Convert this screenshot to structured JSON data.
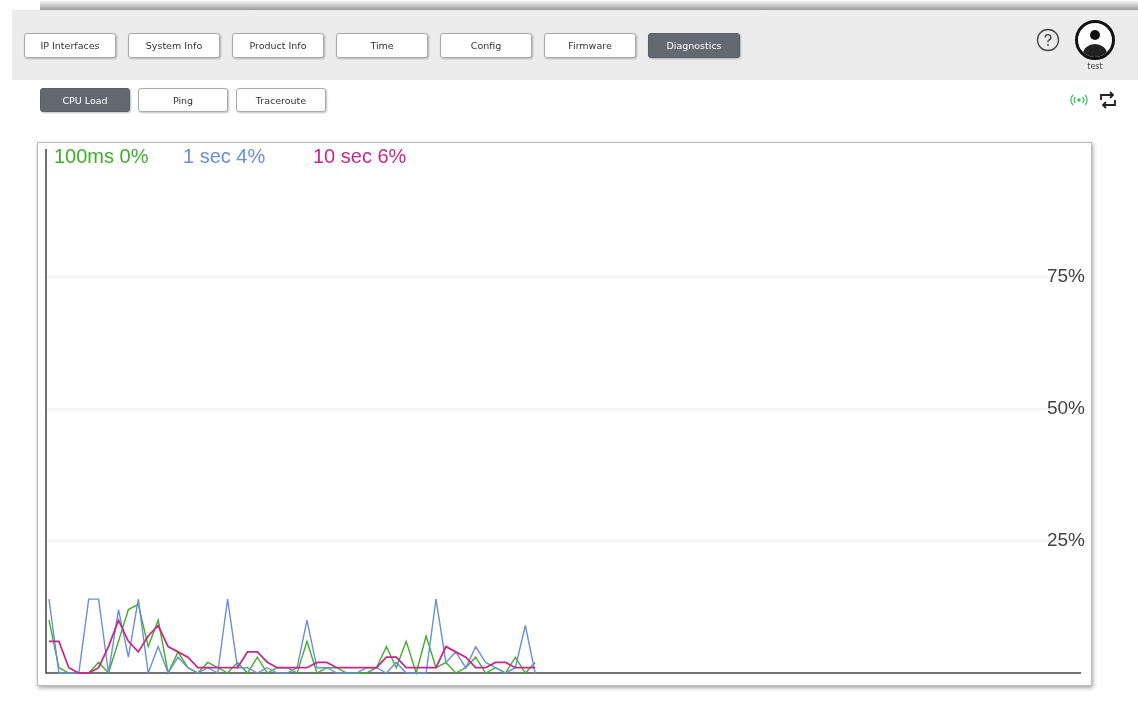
{
  "tabs": [
    {
      "label": "IP Interfaces",
      "selected": false
    },
    {
      "label": "System Info",
      "selected": false
    },
    {
      "label": "Product Info",
      "selected": false
    },
    {
      "label": "Time",
      "selected": false
    },
    {
      "label": "Config",
      "selected": false
    },
    {
      "label": "Firmware",
      "selected": false
    },
    {
      "label": "Diagnostics",
      "selected": true
    }
  ],
  "user": {
    "name": "test"
  },
  "subtabs": [
    {
      "label": "CPU Load",
      "selected": true
    },
    {
      "label": "Ping",
      "selected": false
    },
    {
      "label": "Traceroute",
      "selected": false
    }
  ],
  "chart": {
    "chart_data": {
      "type": "line",
      "categories": [
        null,
        null,
        null,
        null,
        null,
        null,
        null,
        null,
        null,
        null,
        null,
        null,
        null,
        null,
        null,
        null,
        null,
        null,
        null,
        null,
        null,
        null,
        null,
        null,
        null,
        null,
        null,
        null,
        null,
        null,
        null,
        null,
        null,
        null,
        null,
        null,
        null,
        null,
        null,
        null,
        null,
        null,
        null,
        null,
        null,
        null,
        null,
        null,
        null,
        null,
        null,
        null,
        null,
        null,
        null,
        null,
        null,
        null,
        null,
        null,
        null,
        null,
        null,
        null,
        null,
        null,
        null,
        null,
        null,
        null,
        null,
        null,
        null,
        null,
        null,
        null,
        null,
        null,
        null,
        null,
        null,
        null,
        null,
        null,
        null,
        null,
        null,
        null,
        null,
        null,
        null,
        null,
        null,
        null,
        null,
        null,
        null,
        null,
        null,
        null,
        null,
        null,
        null,
        null,
        null
      ],
      "ylim": [
        0,
        100
      ],
      "grid": true,
      "yticks": [
        {
          "value": 25,
          "label": "25%"
        },
        {
          "value": 50,
          "label": "50%"
        },
        {
          "value": 75,
          "label": "75%"
        }
      ],
      "series": [
        {
          "name": "100ms 0%",
          "color": "#3fae2a",
          "values": [
            10,
            1,
            0,
            0,
            0,
            2,
            0,
            6,
            12,
            13,
            5,
            10,
            0,
            4,
            1,
            0,
            2,
            1,
            0,
            2,
            0,
            3,
            0,
            1,
            1,
            0,
            6,
            0,
            1,
            1,
            0,
            0,
            0,
            1,
            5,
            1,
            6,
            0,
            7,
            1,
            2,
            0,
            1,
            3,
            0,
            1,
            0,
            3,
            0,
            2,
            null,
            null,
            null,
            null,
            null,
            null,
            null,
            null,
            null,
            null,
            null,
            null,
            null,
            null,
            null,
            null,
            null,
            null,
            null,
            null,
            null,
            null,
            null,
            null,
            null,
            null,
            null,
            null,
            null,
            null,
            null,
            null,
            null,
            null,
            null,
            null,
            null,
            null,
            null,
            null,
            null,
            null,
            null,
            null,
            null,
            null,
            null,
            null,
            null,
            null,
            null,
            null,
            null,
            null,
            null
          ]
        },
        {
          "name": "1 sec 4%",
          "color": "#6b8fd4",
          "values": [
            14,
            0,
            0,
            0,
            14,
            14,
            0,
            12,
            3,
            14,
            0,
            5,
            0,
            3,
            1,
            0,
            1,
            0,
            14,
            1,
            1,
            0,
            1,
            0,
            0,
            1,
            10,
            1,
            1,
            0,
            0,
            0,
            1,
            1,
            0,
            2,
            0,
            0,
            0,
            14,
            2,
            4,
            1,
            5,
            2,
            1,
            0,
            1,
            9,
            0,
            null,
            null,
            null,
            null,
            null,
            null,
            null,
            null,
            null,
            null,
            null,
            null,
            null,
            null,
            null,
            null,
            null,
            null,
            null,
            null,
            null,
            null,
            null,
            null,
            null,
            null,
            null,
            null,
            null,
            null,
            null,
            null,
            null,
            null,
            null,
            null,
            null,
            null,
            null,
            null,
            null,
            null,
            null,
            null,
            null,
            null,
            null,
            null,
            null,
            null,
            null,
            null,
            null,
            null,
            null
          ]
        },
        {
          "name": "10 sec 6%",
          "color": "#c8288a",
          "values": [
            6,
            6,
            1,
            0,
            0,
            1,
            5,
            10,
            6,
            4,
            7,
            9,
            5,
            4,
            3,
            1,
            1,
            1,
            1,
            1,
            4,
            4,
            2,
            1,
            1,
            1,
            1,
            2,
            2,
            1,
            1,
            1,
            1,
            1,
            3,
            3,
            1,
            1,
            1,
            1,
            5,
            4,
            3,
            1,
            1,
            2,
            2,
            1,
            1,
            1,
            null,
            null,
            null,
            null,
            null,
            null,
            null,
            null,
            null,
            null,
            null,
            null,
            null,
            null,
            null,
            null,
            null,
            null,
            null,
            null,
            null,
            null,
            null,
            null,
            null,
            null,
            null,
            null,
            null,
            null,
            null,
            null,
            null,
            null,
            null,
            null,
            null,
            null,
            null,
            null,
            null,
            null,
            null,
            null,
            null,
            null,
            null,
            null,
            null,
            null,
            null,
            null,
            null,
            null,
            null
          ]
        }
      ]
    }
  }
}
